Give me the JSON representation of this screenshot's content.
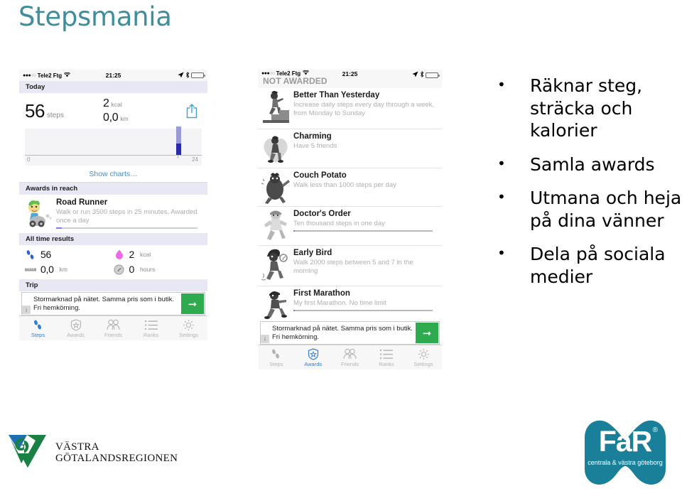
{
  "slide": {
    "title": "Stepsmania",
    "title_color": "#3e8e9c"
  },
  "status_bar": {
    "signal_dots_filled": "●●●",
    "signal_dots_empty": "○○",
    "carrier": "Tele2 Ftg",
    "wifi_icon": "wifi-icon",
    "time": "21:25",
    "location_icon": "location-arrow-icon",
    "bluetooth_icon": "bluetooth-icon",
    "battery_icon": "battery-low-icon",
    "battery_color": "#ef3b36",
    "battery_level_pct": 28
  },
  "phone1": {
    "overlay_label": "",
    "today_header": "Today",
    "summary": {
      "steps_value": "56",
      "steps_unit": "steps",
      "kcal_value": "2",
      "kcal_unit": "kcal",
      "distance_value": "0,0",
      "distance_unit": "km",
      "share_icon": "share-icon"
    },
    "chart": {
      "x_min_label": "0",
      "x_max_label": "24"
    },
    "show_charts": "Show charts…",
    "awards_header": "Awards in reach",
    "award": {
      "title": "Road Runner",
      "desc": "Walk or run 3500 steps in 25 minutes. Awarded once a day",
      "progress_pct": 4,
      "art": "road-runner-award-art"
    },
    "results_header": "All time results",
    "results": [
      {
        "icon": "footsteps-icon",
        "value": "56",
        "unit": ""
      },
      {
        "icon": "flame-icon",
        "value": "2",
        "unit": "kcal"
      },
      {
        "icon": "ruler-icon",
        "value": "0,0",
        "unit": "km"
      },
      {
        "icon": "clock-icon",
        "value": "0",
        "unit": "hours"
      }
    ],
    "trip_header": "Trip",
    "ad": {
      "info_badge": "i",
      "text": "Stormarknad på nätet. Samma pris som i butik. Fri hemkörning.",
      "cta_icon": "arrow-right-icon",
      "cta_color": "#2eaa4f"
    },
    "tabs": [
      {
        "label": "Steps",
        "icon": "footsteps-icon",
        "active": true
      },
      {
        "label": "Awards",
        "icon": "shield-star-icon",
        "active": false
      },
      {
        "label": "Friends",
        "icon": "friends-icon",
        "active": false
      },
      {
        "label": "Ranks",
        "icon": "list-icon",
        "active": false
      },
      {
        "label": "Settings",
        "icon": "gear-icon",
        "active": false
      }
    ]
  },
  "phone2": {
    "overlay_label": "NOT AWARDED",
    "awards": [
      {
        "title": "Better Than Yesterday",
        "desc": "Increase daily steps every day through a week, from Monday to Sunday",
        "art": "treadmill-award-art",
        "progress_pct": 0
      },
      {
        "title": "Charming",
        "desc": "Have 5 friends",
        "art": "heart-award-art",
        "progress_pct": 0
      },
      {
        "title": "Couch Potato",
        "desc": "Walk less than 1000 steps per day",
        "art": "potato-award-art",
        "progress_pct": 0
      },
      {
        "title": "Doctor's Order",
        "desc": "Ten thousand steps in one day",
        "art": "doctor-award-art",
        "progress_pct": 1
      },
      {
        "title": "Early Bird",
        "desc": "Walk 2000 steps between 5 and 7 in the morning",
        "art": "early-bird-award-art",
        "progress_pct": 0
      },
      {
        "title": "First Marathon",
        "desc": "My first Marathon. No time limit",
        "art": "marathon-award-art",
        "progress_pct": 1
      }
    ],
    "ad": {
      "info_badge": "i",
      "text": "Stormarknad på nätet. Samma pris som i butik. Fri hemkörning.",
      "cta_icon": "arrow-right-icon",
      "cta_color": "#2eaa4f"
    },
    "tabs": [
      {
        "label": "Steps",
        "icon": "footsteps-icon",
        "active": false
      },
      {
        "label": "Awards",
        "icon": "shield-star-icon",
        "active": true
      },
      {
        "label": "Friends",
        "icon": "friends-icon",
        "active": false
      },
      {
        "label": "Ranks",
        "icon": "list-icon",
        "active": false
      },
      {
        "label": "Settings",
        "icon": "gear-icon",
        "active": false
      }
    ]
  },
  "bullets": [
    {
      "dot": "•",
      "text": "Räknar steg, sträcka och kalorier"
    },
    {
      "dot": "•",
      "text": "Samla awards"
    },
    {
      "dot": "•",
      "text": "Utmana och heja på dina vänner"
    },
    {
      "dot": "•",
      "text": "Dela på sociala medier"
    }
  ],
  "logos": {
    "vgr": {
      "line1": "VÄSTRA",
      "line2": "GÖTALANDSREGIONEN",
      "blue": "#1f6fb4",
      "green": "#1a8044"
    },
    "far": {
      "mark": "FaR",
      "registered": "®",
      "subtitle": "centrala & västra göteborg",
      "color": "#1a7f99"
    }
  },
  "chart_data": {
    "type": "bar",
    "title": "",
    "xlabel": "",
    "ylabel": "",
    "categories": [
      "0",
      "1",
      "2",
      "3",
      "4",
      "5",
      "6",
      "7",
      "8",
      "9",
      "10",
      "11",
      "12",
      "13",
      "14",
      "15",
      "16",
      "17",
      "18",
      "19",
      "20",
      "21",
      "22",
      "23"
    ],
    "series": [
      {
        "name": "steps-lower",
        "values": [
          0,
          0,
          0,
          0,
          0,
          0,
          0,
          0,
          0,
          0,
          0,
          0,
          0,
          0,
          0,
          0,
          0,
          0,
          0,
          0,
          0,
          20,
          0,
          0
        ]
      },
      {
        "name": "steps-upper",
        "values": [
          0,
          0,
          0,
          0,
          0,
          0,
          0,
          0,
          0,
          0,
          0,
          0,
          0,
          0,
          0,
          0,
          0,
          0,
          0,
          0,
          0,
          36,
          0,
          0
        ]
      }
    ],
    "xlim": [
      0,
      24
    ],
    "ylim": [
      0,
      60
    ],
    "grid": false,
    "legend": "none",
    "tick_labels": [
      "0",
      "24"
    ]
  }
}
